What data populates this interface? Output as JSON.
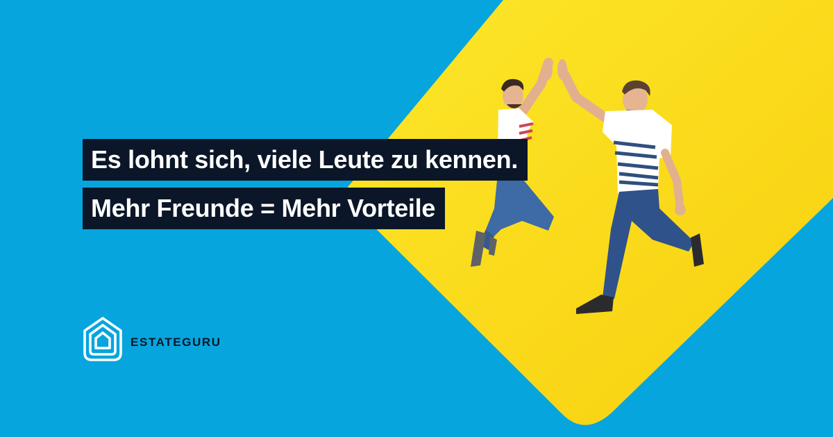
{
  "colors": {
    "background_blue": "#07a5dd",
    "accent_yellow": "#fbd915",
    "headline_bg": "#0b1728",
    "headline_text": "#ffffff",
    "logo_white": "#ffffff"
  },
  "headline": {
    "line1": "Es lohnt sich, viele Leute zu kennen.",
    "line2": "Mehr Freunde = Mehr Vorteile"
  },
  "brand": {
    "name": "ESTATEGURU",
    "logo_icon": "house-outline-icon"
  },
  "photo": {
    "subject": "two-men-jumping-high-five-illustration"
  }
}
